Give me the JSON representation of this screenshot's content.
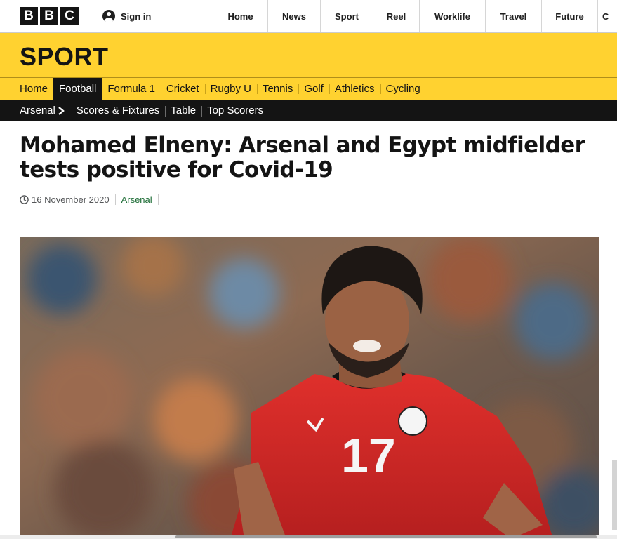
{
  "global_nav": {
    "logo_letters": [
      "B",
      "B",
      "C"
    ],
    "sign_in": "Sign in",
    "items": [
      "Home",
      "News",
      "Sport",
      "Reel",
      "Worklife",
      "Travel",
      "Future",
      "C"
    ]
  },
  "sport_header": {
    "brand": "SPORT"
  },
  "sport_nav": {
    "items": [
      "Home",
      "Football",
      "Formula 1",
      "Cricket",
      "Rugby U",
      "Tennis",
      "Golf",
      "Athletics",
      "Cycling"
    ],
    "active": "Football"
  },
  "sub_nav": {
    "team": "Arsenal",
    "links": [
      "Scores & Fixtures",
      "Table",
      "Top Scorers"
    ]
  },
  "article": {
    "headline": "Mohamed Elneny: Arsenal and Egypt midfielder tests positive for Covid-19",
    "date": "16 November 2020",
    "tag": "Arsenal",
    "hero_image": {
      "shirt_number": "17"
    }
  },
  "colors": {
    "sport_yellow": "#ffd230",
    "nav_black": "#141414",
    "tag_green": "#1a6b33",
    "shirt_red": "#d62a2a"
  },
  "icons": [
    "user-icon",
    "chevron-right-icon",
    "clock-icon"
  ]
}
